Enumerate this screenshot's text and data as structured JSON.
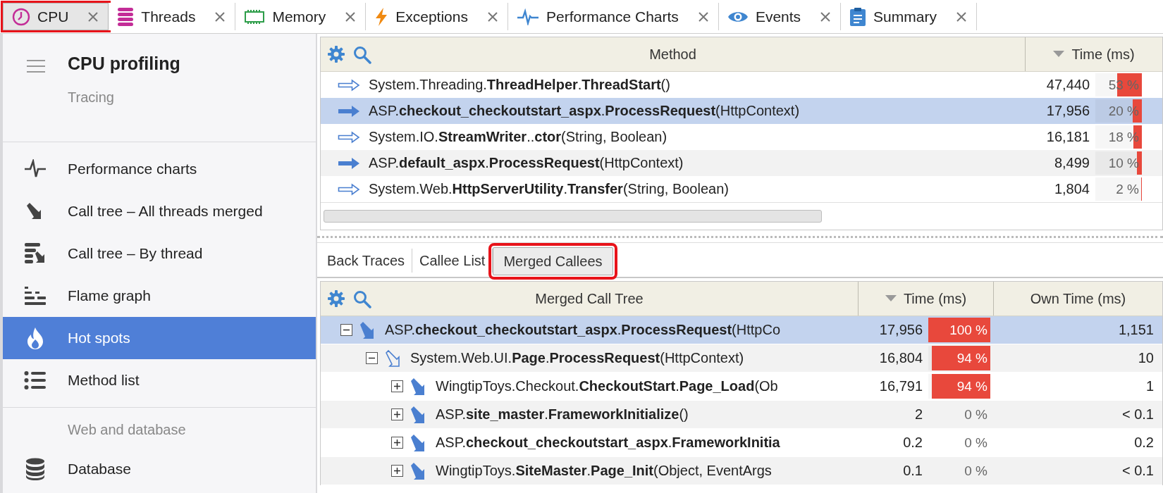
{
  "tabs": [
    {
      "label": "CPU",
      "selected": true,
      "highlighted": true
    },
    {
      "label": "Threads",
      "selected": false,
      "highlighted": false
    },
    {
      "label": "Memory",
      "selected": false,
      "highlighted": false
    },
    {
      "label": "Exceptions",
      "selected": false,
      "highlighted": false
    },
    {
      "label": "Performance Charts",
      "selected": false,
      "highlighted": false
    },
    {
      "label": "Events",
      "selected": false,
      "highlighted": false
    },
    {
      "label": "Summary",
      "selected": false,
      "highlighted": false
    }
  ],
  "sidebar": {
    "title": "CPU profiling",
    "subtitle": "Tracing",
    "sections": [
      {
        "items": [
          {
            "label": "Performance charts",
            "selected": false
          },
          {
            "label": "Call tree – All threads merged",
            "selected": false
          },
          {
            "label": "Call tree – By thread",
            "selected": false
          },
          {
            "label": "Flame graph",
            "selected": false
          },
          {
            "label": "Hot spots",
            "selected": true
          },
          {
            "label": "Method list",
            "selected": false
          }
        ]
      },
      {
        "heading": "Web and database",
        "items": [
          {
            "label": "Database",
            "selected": false
          }
        ]
      }
    ]
  },
  "method_table": {
    "columns": [
      {
        "label": "Method",
        "sorted": false
      },
      {
        "label": "Time (ms)",
        "sorted": true
      }
    ],
    "rows": [
      {
        "method": "System.Threading.**ThreadHelper**.**ThreadStart**()",
        "kind": "outline",
        "time": "47,440",
        "percent": "53 %",
        "level": 0.53,
        "selected": false
      },
      {
        "method": "ASP.**checkout_checkoutstart_aspx**.**ProcessRequest**(HttpContext)",
        "kind": "filled",
        "time": "17,956",
        "percent": "20 %",
        "level": 0.2,
        "selected": true
      },
      {
        "method": "System.IO.**StreamWriter**..**ctor**(String, Boolean)",
        "kind": "outline",
        "time": "16,181",
        "percent": "18 %",
        "level": 0.18,
        "selected": false
      },
      {
        "method": "ASP.**default_aspx**.**ProcessRequest**(HttpContext)",
        "kind": "filled",
        "time": "8,499",
        "percent": "10 %",
        "level": 0.1,
        "selected": false
      },
      {
        "method": "System.Web.**HttpServerUtility**.**Transfer**(String, Boolean)",
        "kind": "outline",
        "time": "1,804",
        "percent": "2 %",
        "level": 0.02,
        "selected": false
      }
    ]
  },
  "detail_tabs": [
    {
      "label": "Back Traces",
      "selected": false,
      "highlighted": false
    },
    {
      "label": "Callee List",
      "selected": false,
      "highlighted": false
    },
    {
      "label": "Merged Callees",
      "selected": true,
      "highlighted": true
    }
  ],
  "call_tree": {
    "columns": [
      {
        "label": "Merged Call Tree",
        "sorted": false
      },
      {
        "label": "Time (ms)",
        "sorted": true
      },
      {
        "label": "Own Time (ms)",
        "sorted": false
      }
    ],
    "nodes": [
      {
        "method": "ASP.**checkout_checkoutstart_aspx**.**ProcessRequest**(HttpCo",
        "kind": "filled",
        "expanded": true,
        "time": "17,956",
        "percent": "100 %",
        "level": 1,
        "own_time": "1,151",
        "selected": true,
        "children": [
          {
            "method": "System.Web.UI.**Page**.**ProcessRequest**(HttpContext)",
            "kind": "outline",
            "expanded": true,
            "time": "16,804",
            "percent": "94 %",
            "level": 0.94,
            "own_time": "10",
            "selected": false,
            "children": [
              {
                "method": "WingtipToys.Checkout.**CheckoutStart**.**Page_Load**(Ob",
                "kind": "filled",
                "expanded": false,
                "time": "16,791",
                "percent": "94 %",
                "level": 0.94,
                "own_time": "1",
                "selected": false
              },
              {
                "method": "ASP.**site_master**.**FrameworkInitialize**()",
                "kind": "filled",
                "expanded": false,
                "time": "2",
                "percent": "0 %",
                "own_time": "< 0.1",
                "selected": false
              },
              {
                "method": "ASP.**checkout_checkoutstart_aspx**.**FrameworkInitia**",
                "kind": "filled",
                "expanded": false,
                "time": "0.2",
                "percent": "0 %",
                "own_time": "0.2",
                "selected": false
              },
              {
                "method": "WingtipToys.**SiteMaster**.**Page_Init**(Object, EventArgs",
                "kind": "filled",
                "expanded": false,
                "time": "0.1",
                "percent": "0 %",
                "own_time": "< 0.1",
                "selected": false
              }
            ]
          }
        ]
      }
    ]
  }
}
